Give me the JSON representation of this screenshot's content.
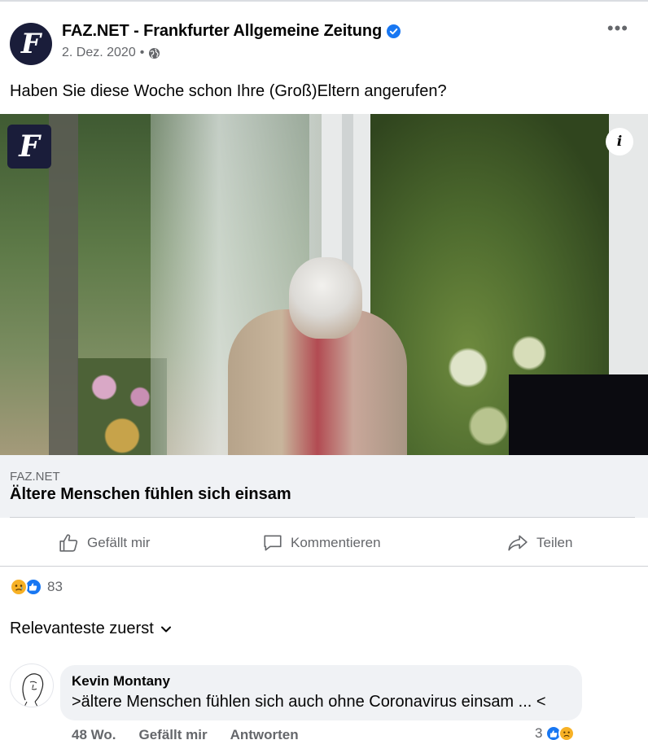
{
  "post": {
    "page_name": "FAZ.NET - Frankfurter Allgemeine Zeitung",
    "avatar_glyph": "F",
    "date": "2. Dez. 2020",
    "separator": "•",
    "privacy_icon": "globe-icon",
    "more_label": "•••",
    "text": "Haben Sie diese Woche schon Ihre (Groß)Eltern angerufen?",
    "verified_color": "#1877f2"
  },
  "media": {
    "logo_glyph": "F",
    "info_label": "i"
  },
  "link": {
    "domain": "FAZ.NET",
    "title": "Ältere Menschen fühlen sich einsam"
  },
  "actions": {
    "like": "Gefällt mir",
    "comment": "Kommentieren",
    "share": "Teilen"
  },
  "reactions": {
    "count": "83",
    "types": [
      "sad",
      "like"
    ]
  },
  "sort": {
    "label": "Relevanteste zuerst"
  },
  "comments": [
    {
      "author": "Kevin Montany",
      "text": ">ältere Menschen fühlen sich auch ohne Coronavirus einsam ... <",
      "age": "48 Wo.",
      "like_label": "Gefällt mir",
      "reply_label": "Antworten",
      "reaction_count": "3"
    }
  ],
  "colors": {
    "accent": "#1877f2",
    "secondary_text": "#65676b",
    "card_bg": "#f0f2f5"
  }
}
